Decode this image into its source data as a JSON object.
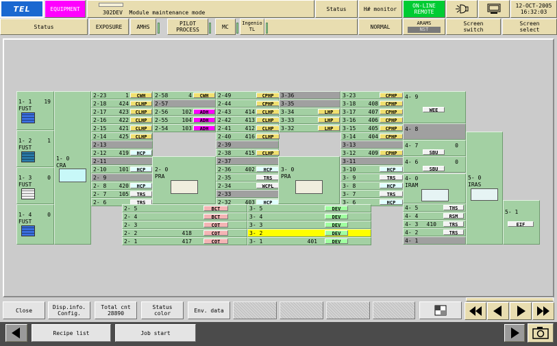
{
  "header": {
    "brand_label": "TEL",
    "equipment_label": "EQUIPMENT",
    "mode_title": "302DEV  Module maintenance mode",
    "status_btn": "Status",
    "monitor_btn": "H# monitor",
    "online_remote": "ON-LINE\nREMOTE",
    "date": "12-OCT-2005",
    "time": "16:32:03"
  },
  "colors": {
    "online_bg": "#00cc33",
    "equipment_bg": "#ff00ff",
    "brand_bg": "#1a68d0",
    "panel_green": "#a3d0a3",
    "tool_tan": "#e8ddb0"
  },
  "tabs": [
    {
      "label": "Status"
    },
    {
      "label": "EXPOSURE"
    },
    {
      "label": "AMHS"
    },
    {
      "label": "PILOT\nPROCESS"
    },
    {
      "label": "MC"
    },
    {
      "label": "Ingenio\nTL"
    },
    {
      "label": "NORMAL"
    },
    {
      "label": "ARAMS"
    },
    {
      "label": "NST"
    },
    {
      "label": "Screen\nswitch"
    },
    {
      "label": "Screen\nselect"
    }
  ],
  "ports": [
    {
      "id": "1- 1",
      "type": "FUST",
      "count": "19"
    },
    {
      "id": "1- 2",
      "type": "FUST",
      "count": "1"
    },
    {
      "id": "1- 3",
      "type": "FUST",
      "count": "0"
    },
    {
      "id": "1- 4",
      "type": "FUST",
      "count": "0"
    }
  ],
  "arms": [
    {
      "id": "1- 0",
      "type": "CRA"
    },
    {
      "id": "2- 0",
      "type": "PRA"
    },
    {
      "id": "3- 0",
      "type": "PRA"
    },
    {
      "id": "4- 0",
      "type": "IRAM"
    },
    {
      "id": "5- 0",
      "type": "IRAS"
    },
    {
      "id": "5- 1",
      "tag": "EIF"
    }
  ],
  "col_2a": [
    {
      "id": "2-23",
      "n": "1",
      "tag": "CWH",
      "c": "y"
    },
    {
      "id": "2-18",
      "n": "424",
      "tag": "CLHP",
      "c": "y"
    },
    {
      "id": "2-17",
      "n": "423",
      "tag": "CLHP",
      "c": "y"
    },
    {
      "id": "2-16",
      "n": "422",
      "tag": "CLHP",
      "c": "y"
    },
    {
      "id": "2-15",
      "n": "421",
      "tag": "CLHP",
      "c": "y"
    },
    {
      "id": "2-14",
      "n": "425",
      "tag": "CLHP",
      "c": "y"
    },
    {
      "id": "2-13",
      "n": "",
      "tag": "",
      "c": "gray"
    },
    {
      "id": "2-12",
      "n": "419",
      "tag": "HCP",
      "c": "l"
    },
    {
      "id": "2-11",
      "n": "",
      "tag": "",
      "c": "gray"
    },
    {
      "id": "2-10",
      "n": "101",
      "tag": "HCP",
      "c": "l"
    },
    {
      "id": "2- 9",
      "n": "",
      "tag": "",
      "c": "gray"
    },
    {
      "id": "2- 8",
      "n": "420",
      "tag": "HCP",
      "c": "l"
    },
    {
      "id": "2- 7",
      "n": "105",
      "tag": "TRS",
      "c": "w"
    },
    {
      "id": "2- 6",
      "n": "",
      "tag": "TRS",
      "c": "w"
    }
  ],
  "col_2b": [
    {
      "id": "2-58",
      "n": "4",
      "tag": "CWH",
      "c": "y"
    },
    {
      "id": "2-57",
      "n": "",
      "tag": "",
      "c": "gray"
    },
    {
      "id": "2-56",
      "n": "102",
      "tag": "ADH",
      "c": "m"
    },
    {
      "id": "2-55",
      "n": "104",
      "tag": "ADH",
      "c": "m"
    },
    {
      "id": "2-54",
      "n": "103",
      "tag": "ADH",
      "c": "m"
    }
  ],
  "col_2c": [
    {
      "id": "2-49",
      "n": "",
      "tag": "CPHP",
      "c": "y"
    },
    {
      "id": "2-44",
      "n": "",
      "tag": "CPHP",
      "c": "y"
    },
    {
      "id": "2-43",
      "n": "414",
      "tag": "CLHP",
      "c": "y"
    },
    {
      "id": "2-42",
      "n": "413",
      "tag": "CLHP",
      "c": "y"
    },
    {
      "id": "2-41",
      "n": "412",
      "tag": "CLHP",
      "c": "y"
    },
    {
      "id": "2-40",
      "n": "416",
      "tag": "CLHP",
      "c": "y"
    },
    {
      "id": "2-39",
      "n": "",
      "tag": "",
      "c": "gray"
    },
    {
      "id": "2-38",
      "n": "415",
      "tag": "CLHP",
      "c": "y"
    },
    {
      "id": "2-37",
      "n": "",
      "tag": "",
      "c": "gray"
    },
    {
      "id": "2-36",
      "n": "402",
      "tag": "HCP",
      "c": "l"
    },
    {
      "id": "2-35",
      "n": "",
      "tag": "TRS",
      "c": "w"
    },
    {
      "id": "2-34",
      "n": "",
      "tag": "WCPL",
      "c": "w"
    },
    {
      "id": "2-33",
      "n": "",
      "tag": "",
      "c": "gray"
    },
    {
      "id": "2-32",
      "n": "403",
      "tag": "HCP",
      "c": "l"
    }
  ],
  "col_3a": [
    {
      "id": "3-36",
      "n": "",
      "tag": "",
      "c": "gray"
    },
    {
      "id": "3-35",
      "n": "",
      "tag": "",
      "c": "gray"
    },
    {
      "id": "3-34",
      "n": "",
      "tag": "LHP",
      "c": "y"
    },
    {
      "id": "3-33",
      "n": "",
      "tag": "LHP",
      "c": "y"
    },
    {
      "id": "3-32",
      "n": "",
      "tag": "LHP",
      "c": "y"
    }
  ],
  "col_3b": [
    {
      "id": "3-23",
      "n": "",
      "tag": "CPHP",
      "c": "y"
    },
    {
      "id": "3-18",
      "n": "408",
      "tag": "CPHP",
      "c": "y"
    },
    {
      "id": "3-17",
      "n": "407",
      "tag": "CPHP",
      "c": "y"
    },
    {
      "id": "3-16",
      "n": "406",
      "tag": "CPHP",
      "c": "y"
    },
    {
      "id": "3-15",
      "n": "405",
      "tag": "CPHP",
      "c": "y"
    },
    {
      "id": "3-14",
      "n": "404",
      "tag": "CPHP",
      "c": "y"
    },
    {
      "id": "3-13",
      "n": "",
      "tag": "",
      "c": "gray"
    },
    {
      "id": "3-12",
      "n": "409",
      "tag": "CPHP",
      "c": "y"
    },
    {
      "id": "3-11",
      "n": "",
      "tag": "",
      "c": "gray"
    },
    {
      "id": "3-10",
      "n": "",
      "tag": "HCP",
      "c": "l"
    },
    {
      "id": "3- 9",
      "n": "",
      "tag": "TRS",
      "c": "w"
    },
    {
      "id": "3- 8",
      "n": "",
      "tag": "HCP",
      "c": "l"
    },
    {
      "id": "3- 7",
      "n": "",
      "tag": "TRS",
      "c": "w"
    },
    {
      "id": "3- 6",
      "n": "",
      "tag": "HCP",
      "c": "l"
    }
  ],
  "col_4": [
    {
      "id": "4- 9",
      "tag": "WEE"
    },
    {
      "id": "4- 8",
      "tag": ""
    },
    {
      "id": "4- 7",
      "n": "0",
      "tag": "SBU"
    },
    {
      "id": "4- 6",
      "n": "0",
      "tag": "SBU"
    }
  ],
  "col_4_bottom": [
    {
      "id": "4- 5",
      "n": "",
      "tag": "THS",
      "c": "w"
    },
    {
      "id": "4- 4",
      "n": "",
      "tag": "RSM",
      "c": "w"
    },
    {
      "id": "4- 3",
      "n": "410",
      "tag": "TRS",
      "c": "w"
    },
    {
      "id": "4- 2",
      "n": "",
      "tag": "TRS",
      "c": "w"
    },
    {
      "id": "4- 1",
      "n": "",
      "tag": "",
      "c": "gray"
    }
  ],
  "row_2_bottom": [
    {
      "id": "2- 5",
      "n": "",
      "tag": "BCT",
      "c": "p"
    },
    {
      "id": "2- 4",
      "n": "",
      "tag": "BCT",
      "c": "p"
    },
    {
      "id": "2- 3",
      "n": "",
      "tag": "COT",
      "c": "p"
    },
    {
      "id": "2- 2",
      "n": "418",
      "tag": "COT",
      "c": "p"
    },
    {
      "id": "2- 1",
      "n": "417",
      "tag": "COT",
      "c": "p"
    }
  ],
  "row_3_bottom": [
    {
      "id": "3- 5",
      "n": "",
      "tag": "DEV",
      "c": "g"
    },
    {
      "id": "3- 4",
      "n": "",
      "tag": "DEV",
      "c": "g"
    },
    {
      "id": "3- 3",
      "n": "",
      "tag": "DEV",
      "c": "g"
    },
    {
      "id": "3- 2",
      "n": "",
      "tag": "DEV",
      "c": "g",
      "hl": true
    },
    {
      "id": "3- 1",
      "n": "401",
      "tag": "DEV",
      "c": "g"
    }
  ],
  "footer": {
    "close": "Close",
    "disp_info": "Disp.info.\nConfig.",
    "total_cnt": "Total cnt\n28890",
    "status_color": "Status\ncolor",
    "env_data": "Env. data",
    "recipe_list": "Recipe list",
    "job_start": "Job start"
  }
}
